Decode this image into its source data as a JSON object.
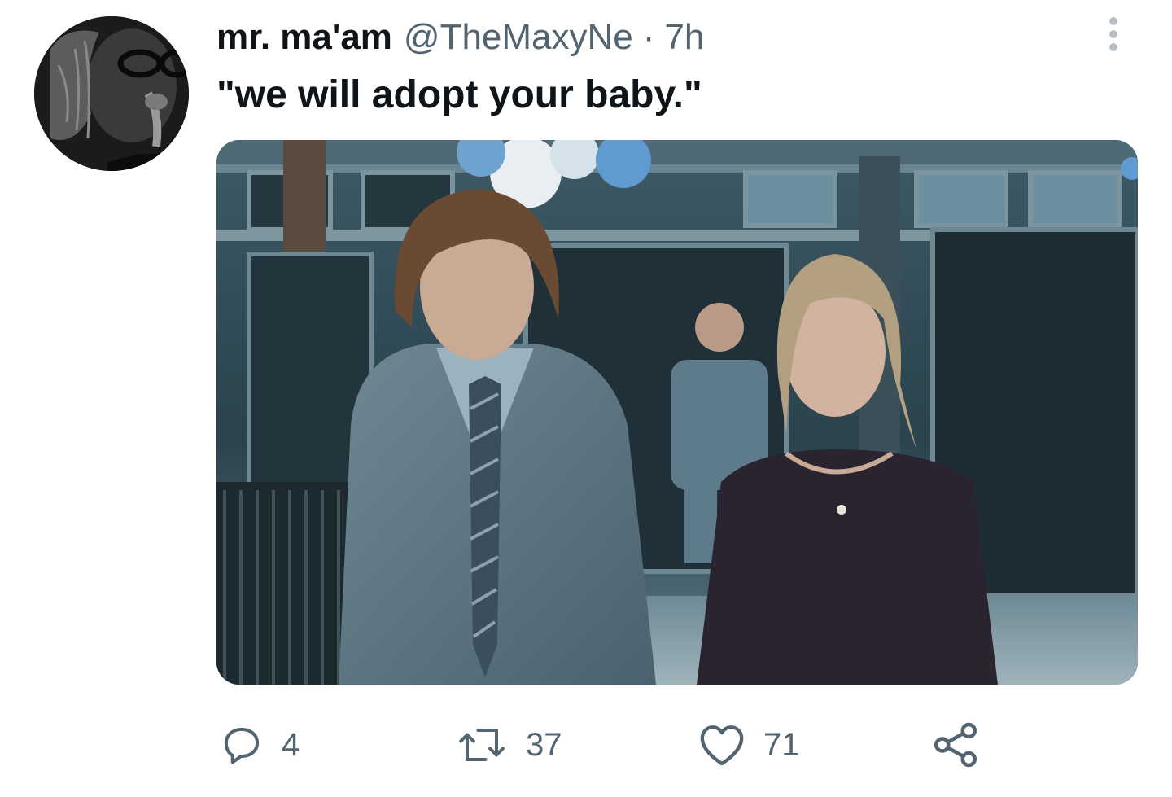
{
  "tweet": {
    "display_name": "mr. ma'am",
    "handle": "@TheMaxyNe",
    "separator": "·",
    "time": "7h",
    "text": "\"we will adopt your baby.\"",
    "avatar_icon": "user-avatar",
    "more_icon": "more-vertical-icon"
  },
  "actions": {
    "reply": {
      "icon": "reply-icon",
      "count": "4"
    },
    "retweet": {
      "icon": "retweet-icon",
      "count": "37"
    },
    "like": {
      "icon": "heart-icon",
      "count": "71"
    },
    "share": {
      "icon": "share-icon"
    }
  },
  "colors": {
    "text": "#0f1419",
    "secondary": "#536471",
    "dots": "#b6bec6"
  }
}
